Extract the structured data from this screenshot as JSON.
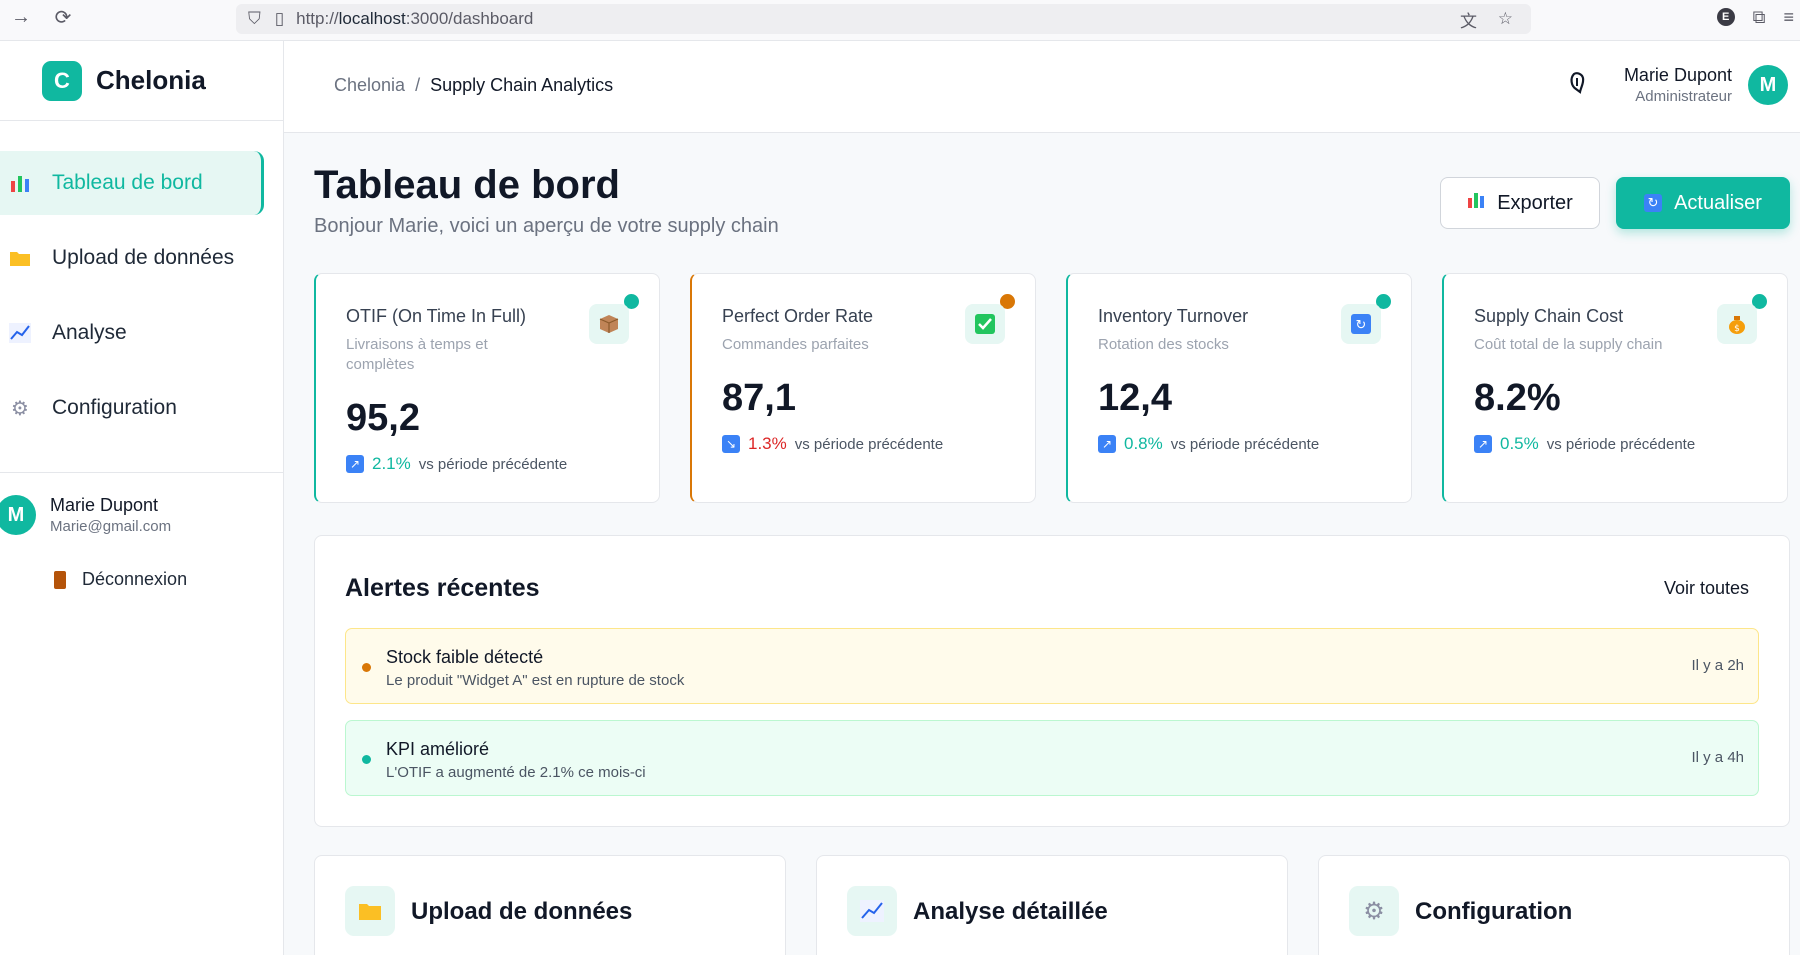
{
  "browser": {
    "url_prefix": "http://",
    "url_host": "localhost",
    "url_rest": ":3000/dashboard",
    "profile_initial": "E"
  },
  "brand": {
    "logo_letter": "C",
    "name": "Chelonia"
  },
  "sidebar": {
    "items": [
      {
        "label": "Tableau de bord",
        "icon": "bar-chart-icon",
        "active": true
      },
      {
        "label": "Upload de données",
        "icon": "folder-icon",
        "active": false
      },
      {
        "label": "Analyse",
        "icon": "line-chart-icon",
        "active": false
      },
      {
        "label": "Configuration",
        "icon": "gear-icon",
        "active": false
      }
    ],
    "user": {
      "initial": "M",
      "name": "Marie Dupont",
      "email": "Marie@gmail.com"
    },
    "logout_label": "Déconnexion"
  },
  "header": {
    "breadcrumb_root": "Chelonia",
    "breadcrumb_sep": "/",
    "breadcrumb_current": "Supply Chain Analytics",
    "user_name": "Marie Dupont",
    "user_role": "Administrateur",
    "user_initial": "M"
  },
  "page": {
    "title": "Tableau de bord",
    "subtitle": "Bonjour Marie, voici un aperçu de votre supply chain",
    "export_label": "Exporter",
    "refresh_label": "Actualiser"
  },
  "kpis": [
    {
      "title": "OTIF (On Time In Full)",
      "desc": "Livraisons à temps et complètes",
      "value": "95,2",
      "trend": "2.1%",
      "direction": "up",
      "compare": "vs période précédente",
      "status": "ok"
    },
    {
      "title": "Perfect Order Rate",
      "desc": "Commandes parfaites",
      "value": "87,1",
      "trend": "1.3%",
      "direction": "down",
      "compare": "vs période précédente",
      "status": "warn"
    },
    {
      "title": "Inventory Turnover",
      "desc": "Rotation des stocks",
      "value": "12,4",
      "trend": "0.8%",
      "direction": "up",
      "compare": "vs période précédente",
      "status": "ok"
    },
    {
      "title": "Supply Chain Cost",
      "desc": "Coût total de la supply chain",
      "value": "8.2%",
      "trend": "0.5%",
      "direction": "up",
      "compare": "vs période précédente",
      "status": "ok"
    }
  ],
  "alerts": {
    "title": "Alertes récentes",
    "see_all": "Voir toutes",
    "items": [
      {
        "title": "Stock faible détecté",
        "message": "Le produit \"Widget A\" est en rupture de stock",
        "time": "Il y a 2h",
        "level": "warning"
      },
      {
        "title": "KPI amélioré",
        "message": "L'OTIF a augmenté de 2.1% ce mois-ci",
        "time": "Il y a 4h",
        "level": "success"
      }
    ]
  },
  "quick_actions": [
    {
      "title": "Upload de données",
      "icon": "folder-icon"
    },
    {
      "title": "Analyse détaillée",
      "icon": "line-chart-icon"
    },
    {
      "title": "Configuration",
      "icon": "gear-icon"
    }
  ],
  "colors": {
    "accent": "#10b8a0",
    "warning": "#d97706",
    "danger": "#dc2626"
  }
}
